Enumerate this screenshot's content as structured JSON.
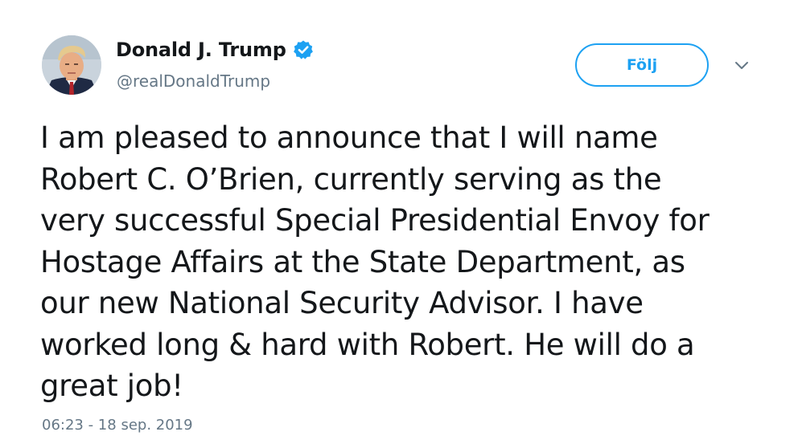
{
  "author": {
    "display_name": "Donald J. Trump",
    "handle": "@realDonaldTrump",
    "verified": true
  },
  "actions": {
    "follow_label": "Följ"
  },
  "tweet": {
    "lines": [
      "I am pleased to announce that I will name",
      "Robert C. O’Brien, currently serving as the",
      "very successful Special Presidential Envoy for",
      "Hostage Affairs at the State Department, as",
      "our new National Security Advisor. I have",
      "worked long & hard with Robert. He will do a",
      "great job!"
    ],
    "timestamp": "06:23 - 18 sep. 2019"
  },
  "colors": {
    "accent": "#1da1f2",
    "text": "#14171a",
    "muted": "#657786"
  },
  "icons": {
    "verified": "verified-badge-icon",
    "menu": "chevron-down-icon"
  }
}
